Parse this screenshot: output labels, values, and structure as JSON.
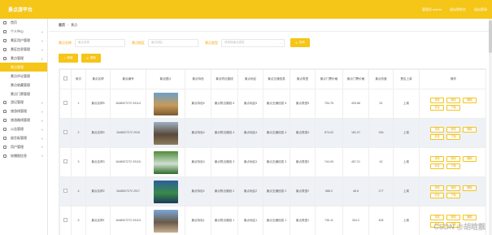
{
  "brand": "景点游平台",
  "top": {
    "user": "管理员 admin",
    "home": "退出到前台",
    "logout": "退出登录"
  },
  "sidebar": [
    {
      "label": "首页",
      "active": false,
      "sub": false,
      "arrow": false
    },
    {
      "label": "个人中心",
      "active": false,
      "sub": false,
      "arrow": true
    },
    {
      "label": "景区用户管理",
      "active": false,
      "sub": false,
      "arrow": true
    },
    {
      "label": "景区信息管理",
      "active": false,
      "sub": false,
      "arrow": true
    },
    {
      "label": "景点管理",
      "active": false,
      "sub": false,
      "arrow": true
    },
    {
      "label": "景点管理",
      "active": true,
      "sub": true,
      "arrow": false
    },
    {
      "label": "景点评论管理",
      "active": false,
      "sub": true,
      "arrow": false
    },
    {
      "label": "景点收藏管理",
      "active": false,
      "sub": true,
      "arrow": false
    },
    {
      "label": "景点门票管理",
      "active": false,
      "sub": true,
      "arrow": false
    },
    {
      "label": "游记管理",
      "active": false,
      "sub": false,
      "arrow": true
    },
    {
      "label": "旅游线管理",
      "active": false,
      "sub": false,
      "arrow": true
    },
    {
      "label": "旅游路线管理",
      "active": false,
      "sub": false,
      "arrow": true
    },
    {
      "label": "公告管理",
      "active": false,
      "sub": false,
      "arrow": true
    },
    {
      "label": "留言板管理",
      "active": false,
      "sub": false,
      "arrow": true
    },
    {
      "label": "用户管理",
      "active": false,
      "sub": false,
      "arrow": true
    },
    {
      "label": "轮播图信息",
      "active": false,
      "sub": false,
      "arrow": true
    }
  ],
  "breadcrumb": {
    "home": "首页",
    "current": "景点"
  },
  "search": {
    "name_label": "景点名称",
    "name_ph": "景点名称",
    "area_label": "景点地区",
    "area_ph": "景点地区",
    "type_label": "景点类型",
    "type_ph": "请选择景点类型",
    "button": "查询"
  },
  "toolbar": {
    "add": "新增",
    "delete": "删除"
  },
  "columns": [
    "",
    "索引",
    "景点名称",
    "景点编号",
    "景点图片",
    "景点特色",
    "景点附近路线",
    "景点地区",
    "景点交通信息",
    "景点类型",
    "景点门票价格",
    "景点门票价格",
    "景点热度",
    "是否上架",
    "操作"
  ],
  "ops": [
    "详情",
    "修改",
    "删除",
    "评论",
    "下架"
  ],
  "rows": [
    {
      "idx": "1",
      "name": "景点名称5",
      "no": "1648927272 29114",
      "feature": "景点特色5",
      "route": "景点附近路线 5",
      "area": "景点地区5",
      "traffic": "景点交通信息 5",
      "type": "景点类型5",
      "price1": "754.76",
      "price2": "493.86",
      "heat": "51",
      "status": "上架",
      "img": [
        "#6aa0c8",
        "#c79a5a",
        "#7a5a30"
      ]
    },
    {
      "idx": "2",
      "name": "景点名称4",
      "no": "1648927272 2916",
      "feature": "景点特色4",
      "route": "景点附近路线 4",
      "area": "景点地区4",
      "traffic": "景点交通信息 4",
      "type": "景点类型4",
      "price1": "574.02",
      "price2": "181.07",
      "heat": "246",
      "status": "上架",
      "img": [
        "#9fb0c2",
        "#5a4a3a",
        "#8a7b5a"
      ]
    },
    {
      "idx": "3",
      "name": "景点名称3",
      "no": "1648927272 29115",
      "feature": "景点特色3",
      "route": "景点附近路线 3",
      "area": "景点地区3",
      "traffic": "景点交通信息 3",
      "type": "景点类型3",
      "price1": "744.09",
      "price2": "457.21",
      "heat": "42",
      "status": "上架",
      "img": [
        "#4f8a3a",
        "#cfe0d0",
        "#2f6a2a"
      ]
    },
    {
      "idx": "4",
      "name": "景点名称2",
      "no": "1648927272 2917",
      "feature": "景点特色2",
      "route": "景点附近路线 2",
      "area": "景点地区2",
      "traffic": "景点交通信息 2",
      "type": "景点类型2",
      "price1": "586.2",
      "price2": "46.6",
      "heat": "177",
      "status": "上架",
      "img": [
        "#2a5f9a",
        "#3a8a4a",
        "#1a3a5a"
      ]
    },
    {
      "idx": "5",
      "name": "景点名称1",
      "no": "1648927272 29119",
      "feature": "景点特色1",
      "route": "景点附近路线 1",
      "area": "景点地区1",
      "traffic": "景点交通信息 1",
      "type": "景点类型1",
      "price1": "735.11",
      "price2": "304.2",
      "heat": "405",
      "status": "上架",
      "img": [
        "#7aa8d8",
        "#6a5a4a",
        "#c8b090"
      ]
    }
  ],
  "watermark": "CSDN @胡晗靓"
}
